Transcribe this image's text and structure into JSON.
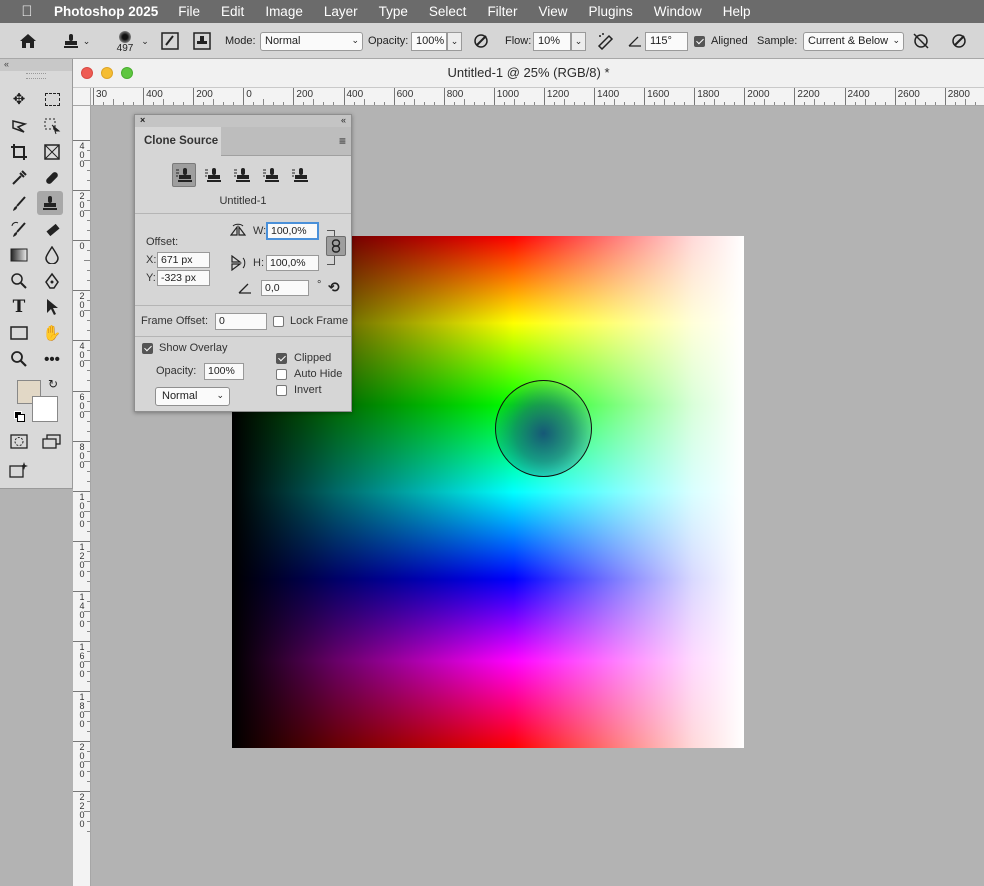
{
  "menubar": {
    "app": "Photoshop 2025",
    "items": [
      "File",
      "Edit",
      "Image",
      "Layer",
      "Type",
      "Select",
      "Filter",
      "View",
      "Plugins",
      "Window",
      "Help"
    ]
  },
  "options": {
    "brush_size": "497",
    "mode_label": "Mode:",
    "mode_value": "Normal",
    "opacity_label": "Opacity:",
    "opacity_value": "100%",
    "flow_label": "Flow:",
    "flow_value": "10%",
    "angle_value": "115°",
    "aligned_label": "Aligned",
    "aligned_checked": true,
    "sample_label": "Sample:",
    "sample_value": "Current & Below"
  },
  "document": {
    "title": "Untitled-1 @ 25% (RGB/8) *",
    "hruler_labels": [
      "30",
      "400",
      "200",
      "0",
      "200",
      "400",
      "600",
      "800",
      "1000",
      "1200",
      "1400",
      "1600",
      "1800",
      "2000",
      "2200",
      "2400",
      "2600",
      "2800"
    ],
    "vruler_labels": [
      "4 0 0",
      "2 0 0",
      "0",
      "2 0 0",
      "4 0 0",
      "6 0 0",
      "8 0 0",
      "1 0 0 0",
      "1 2 0 0",
      "1 4 0 0",
      "1 6 0 0",
      "1 8 0 0",
      "2 0 0 0",
      "2 2 0 0"
    ]
  },
  "clone_panel": {
    "tab": "Clone Source",
    "source_name": "Untitled-1",
    "offset_label": "Offset:",
    "x_label": "X:",
    "x_value": "671 px",
    "y_label": "Y:",
    "y_value": "-323 px",
    "w_label": "W:",
    "w_value": "100,0%",
    "h_label": "H:",
    "h_value": "100,0%",
    "angle_value": "0,0",
    "degree": "°",
    "frame_offset_label": "Frame Offset:",
    "frame_offset_value": "0",
    "lock_frame_label": "Lock Frame",
    "lock_frame_checked": false,
    "show_overlay_label": "Show Overlay",
    "show_overlay_checked": true,
    "opacity_label": "Opacity:",
    "opacity_value": "100%",
    "blend_value": "Normal",
    "clipped_label": "Clipped",
    "clipped_checked": true,
    "auto_hide_label": "Auto Hide",
    "auto_hide_checked": false,
    "invert_label": "Invert",
    "invert_checked": false
  },
  "colors": {
    "foreground": "#e2d8c6",
    "background": "#ffffff"
  }
}
